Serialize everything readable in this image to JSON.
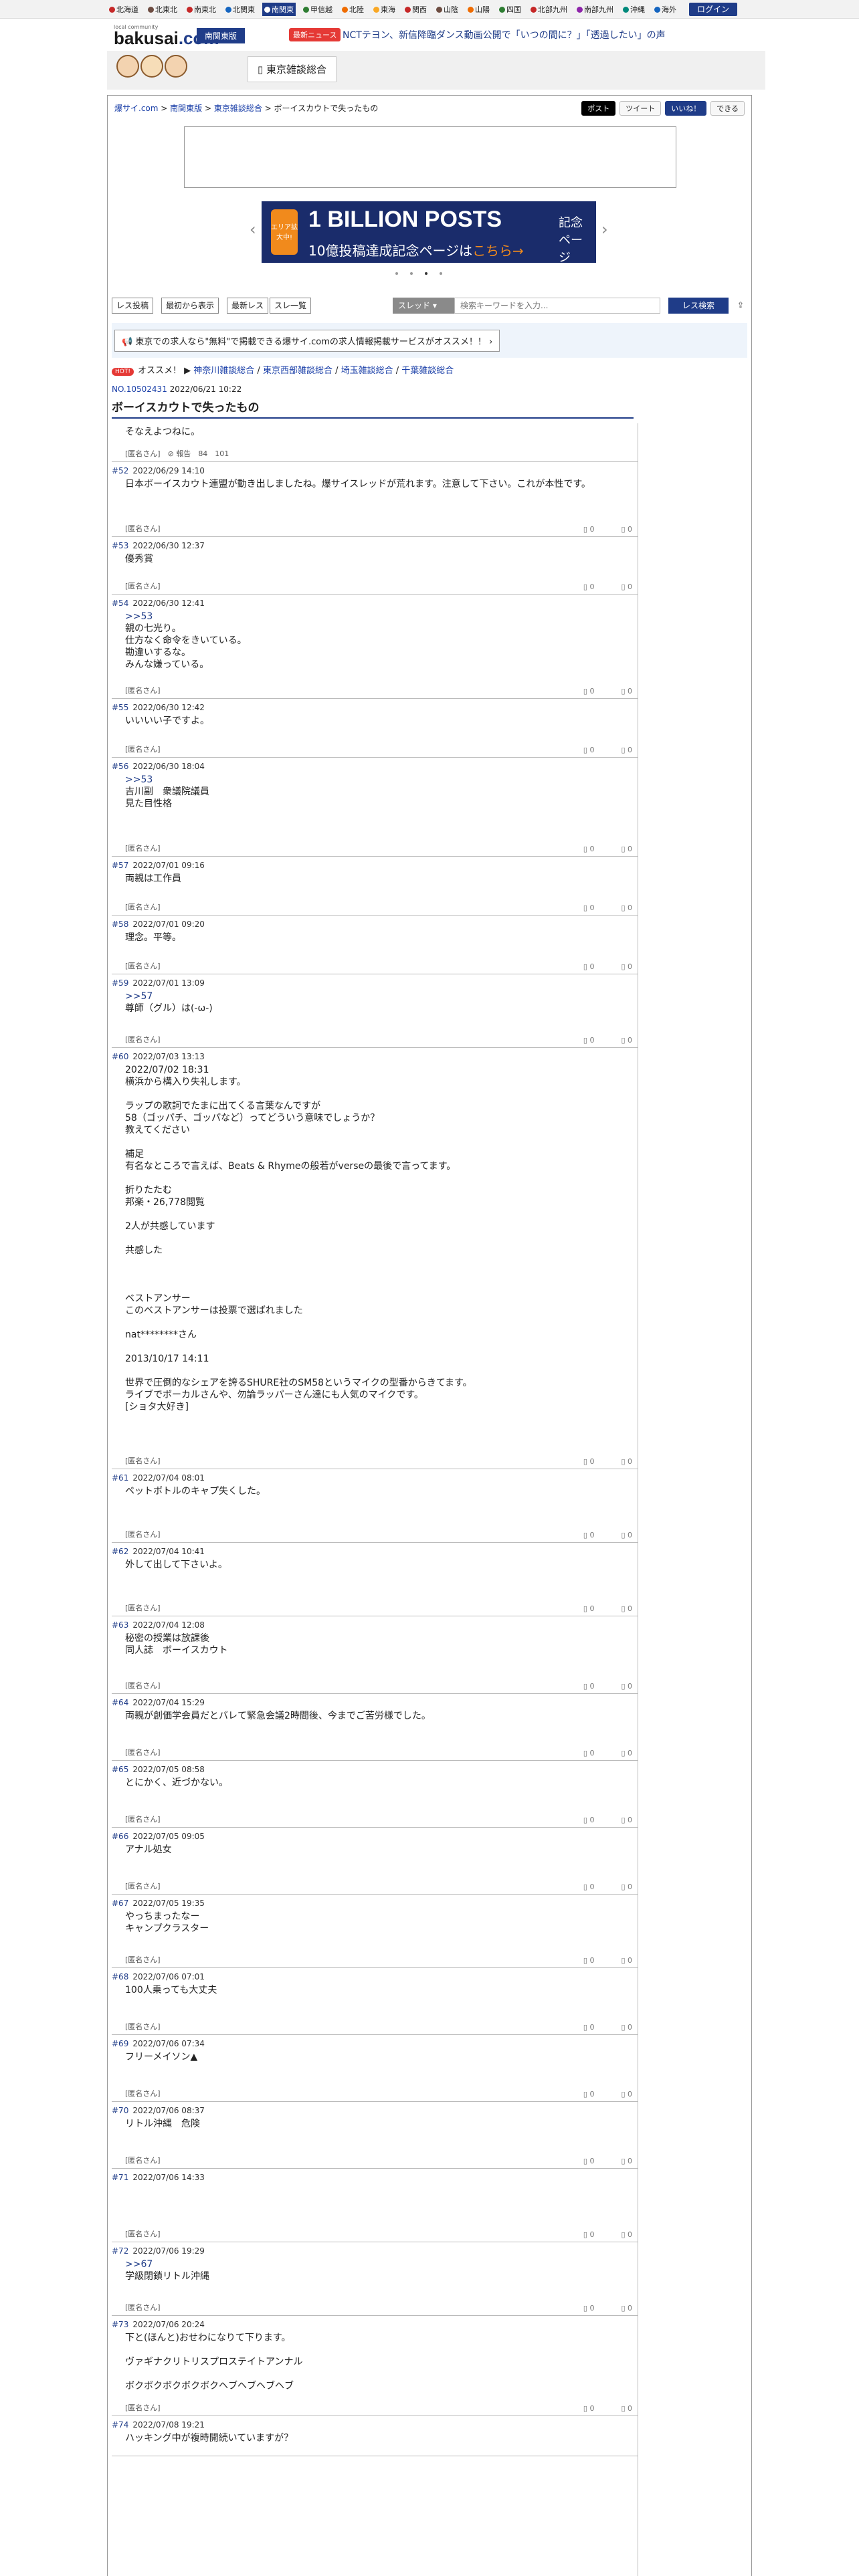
{
  "topbar": {
    "regions": [
      {
        "label": "北海道",
        "color": "#c62828"
      },
      {
        "label": "北東北",
        "color": "#6d4c41"
      },
      {
        "label": "南東北",
        "color": "#c62828"
      },
      {
        "label": "北関東",
        "color": "#1565c0"
      },
      {
        "label": "南関東",
        "color": "#ffffff",
        "active": true
      },
      {
        "label": "甲信越",
        "color": "#2e7d32"
      },
      {
        "label": "北陸",
        "color": "#ef6c00"
      },
      {
        "label": "東海",
        "color": "#f9a825"
      },
      {
        "label": "関西",
        "color": "#c62828"
      },
      {
        "label": "山陰",
        "color": "#6d4c41"
      },
      {
        "label": "山陽",
        "color": "#ef6c00"
      },
      {
        "label": "四国",
        "color": "#2e7d32"
      },
      {
        "label": "北部九州",
        "color": "#c62828"
      },
      {
        "label": "南部九州",
        "color": "#8e24aa"
      },
      {
        "label": "沖縄",
        "color": "#00897b"
      },
      {
        "label": "海外",
        "color": "#1565c0"
      }
    ],
    "login_label": "ログイン"
  },
  "header": {
    "logo_sub": "local community",
    "logo_main": "bakusai",
    "logo_tld": ".com",
    "region_tag": "南関東版",
    "news_badge": "最新ニュース",
    "news_text": "NCTテヨン、新信降臨ダンス動画公開で「いつの間に？」「透過したい」の声"
  },
  "board": {
    "name": "東京雑談総合"
  },
  "breadcrumb": {
    "home": "爆サイ.com",
    "region": "南関東版",
    "board": "東京雑談総合",
    "current": "ボーイスカウトで失ったもの"
  },
  "social": {
    "x": "ポスト",
    "tweet": "ツイート",
    "like": "いいね！",
    "save": "できる"
  },
  "carousel": {
    "left_badge": "エリア拡大中!",
    "title": "1 BILLION POSTS",
    "sub_prefix": "10億投稿達成記念ページは",
    "sub_highlight": "こちら→",
    "right_text": "記念ページ"
  },
  "toolbar": {
    "post_button": "レス投稿",
    "latest_button": "最初から表示",
    "newest_button": "最新レス",
    "list_button": "スレ一覧",
    "search_scope": "スレッド",
    "search_placeholder": "検索キーワードを入力...",
    "search_button": "レス検索"
  },
  "promo": {
    "text": "東京での求人なら\"無料\"で掲載できる爆サイ.comの求人情報掲載サービスがオススメ！！"
  },
  "recommend": {
    "hot": "HOT!",
    "label": "オススメ！",
    "links": [
      "神奈川雑談総合",
      "東京西部雑談総合",
      "埼玉雑談総合",
      "千葉雑談総合"
    ]
  },
  "thread": {
    "id": "NO.10502431",
    "date": "2022/06/21 10:22",
    "title": "ボーイスカウトで失ったもの",
    "first_body": "そなえよつねに。",
    "first_author": "[匿名さん]",
    "first_report": "報告",
    "first_stats": "84　101"
  },
  "posts": [
    {
      "num": "#52",
      "date": "2022/06/29 14:10",
      "body": "日本ボーイスカウト連盟が動き出しましたね。爆サイスレッドが荒れます。注意して下さい。これが本性です。",
      "author": "[匿名さん]",
      "up": "0",
      "down": "0"
    },
    {
      "num": "#53",
      "date": "2022/06/30 12:37",
      "body": "優秀賞",
      "author": "[匿名さん]",
      "up": "0",
      "down": "0"
    },
    {
      "num": "#54",
      "date": "2022/06/30 12:41",
      "anchor": ">>53",
      "body": "親の七光り。\n仕方なく命令をきいている。\n勘違いするな。\nみんな嫌っている。",
      "author": "[匿名さん]",
      "up": "0",
      "down": "0"
    },
    {
      "num": "#55",
      "date": "2022/06/30 12:42",
      "body": "いいいい子ですよ。",
      "author": "[匿名さん]",
      "up": "0",
      "down": "0"
    },
    {
      "num": "#56",
      "date": "2022/06/30 18:04",
      "anchor": ">>53",
      "body": "吉川副　衆議院議員\n見た目性格",
      "author": "[匿名さん]",
      "up": "0",
      "down": "0"
    },
    {
      "num": "#57",
      "date": "2022/07/01 09:16",
      "body": "両親は工作員",
      "author": "[匿名さん]",
      "up": "0",
      "down": "0"
    },
    {
      "num": "#58",
      "date": "2022/07/01 09:20",
      "body": "理念。平等。",
      "author": "[匿名さん]",
      "up": "0",
      "down": "0"
    },
    {
      "num": "#59",
      "date": "2022/07/01 13:09",
      "anchor": ">>57",
      "body": "尊師（グル）は(-ω-)",
      "author": "[匿名さん]",
      "up": "0",
      "down": "0"
    },
    {
      "num": "#60",
      "date": "2022/07/03 13:13",
      "body": "2022/07/02 18:31\n横浜から構入り失礼します。\n\nラップの歌詞でたまに出てくる言葉なんですが\n58（ゴッパチ、ゴッパなど）ってどういう意味でしょうか？\n教えてください\n\n補足\n有名なところで言えば、Beats & Rhymeの般若がverseの最後で言ってます。\n\n折りたたむ\n邦楽・26,778閲覧\n\n2人が共感しています\n\n共感した\n\n\n\nベストアンサー\nこのベストアンサーは投票で選ばれました\n\nnat********さん\n\n2013/10/17 14:11\n\n世界で圧倒的なシェアを誇るSHURE社のSM58というマイクの型番からきてます。\nライブでボーカルさんや、勿論ラッパーさん達にも人気のマイクです。\n[ショタ大好き]",
      "author": "[匿名さん]",
      "up": "0",
      "down": "0"
    },
    {
      "num": "#61",
      "date": "2022/07/04 08:01",
      "body": "ペットボトルのキャプ失くした。",
      "author": "[匿名さん]",
      "up": "0",
      "down": "0"
    },
    {
      "num": "#62",
      "date": "2022/07/04 10:41",
      "body": "外して出して下さいよ。",
      "author": "[匿名さん]",
      "up": "0",
      "down": "0"
    },
    {
      "num": "#63",
      "date": "2022/07/04 12:08",
      "body": "秘密の授業は放課後\n同人誌　ボーイスカウト",
      "author": "[匿名さん]",
      "up": "0",
      "down": "0"
    },
    {
      "num": "#64",
      "date": "2022/07/04 15:29",
      "body": "両親が創価学会員だとバレて緊急会議2時間後、今までご苦労様でした。",
      "author": "[匿名さん]",
      "up": "0",
      "down": "0"
    },
    {
      "num": "#65",
      "date": "2022/07/05 08:58",
      "body": "とにかく、近づかない。",
      "author": "[匿名さん]",
      "up": "0",
      "down": "0"
    },
    {
      "num": "#66",
      "date": "2022/07/05 09:05",
      "body": "アナル処女",
      "author": "[匿名さん]",
      "up": "0",
      "down": "0"
    },
    {
      "num": "#67",
      "date": "2022/07/05 19:35",
      "body": "やっちまったなー\nキャンプクラスター",
      "author": "[匿名さん]",
      "up": "0",
      "down": "0"
    },
    {
      "num": "#68",
      "date": "2022/07/06 07:01",
      "body": "100人乗っても大丈夫",
      "author": "[匿名さん]",
      "up": "0",
      "down": "0"
    },
    {
      "num": "#69",
      "date": "2022/07/06 07:34",
      "body": "フリーメイソン▲",
      "author": "[匿名さん]",
      "up": "0",
      "down": "0"
    },
    {
      "num": "#70",
      "date": "2022/07/06 08:37",
      "body": "リトル沖縄　危険",
      "author": "[匿名さん]",
      "up": "0",
      "down": "0"
    },
    {
      "num": "#71",
      "date": "2022/07/06 14:33",
      "body": "",
      "author": "[匿名さん]",
      "up": "0",
      "down": "0"
    },
    {
      "num": "#72",
      "date": "2022/07/06 19:29",
      "anchor": ">>67",
      "body": "学級閉鎖リトル沖縄",
      "author": "[匿名さん]",
      "up": "0",
      "down": "0"
    },
    {
      "num": "#73",
      "date": "2022/07/06 20:24",
      "body": "下と(ほんと)おせわになりて下ります。\n\nヴァギナクリトリスプロステイトアンナル\n\nボクボクボクボクボクヘブヘブヘブヘブ",
      "author": "[匿名さん]",
      "up": "0",
      "down": "0"
    },
    {
      "num": "#74",
      "date": "2022/07/08 19:21",
      "body": "ハッキング中が複時開続いていますが？",
      "author": "",
      "up": "",
      "down": ""
    }
  ]
}
